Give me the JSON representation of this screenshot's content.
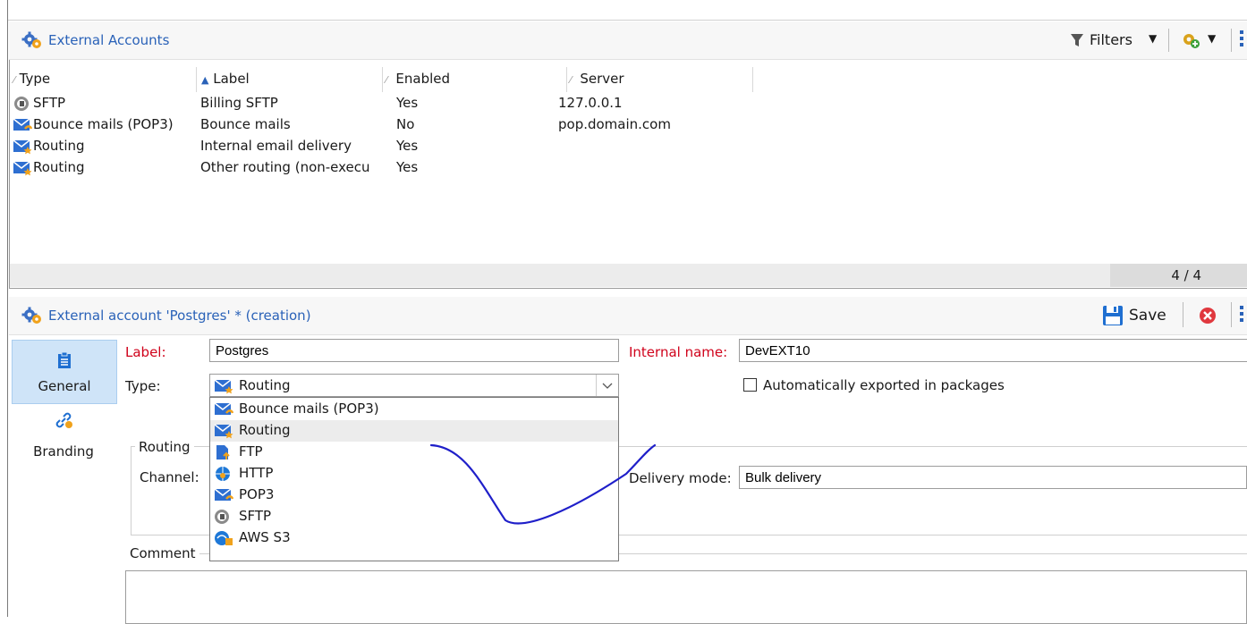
{
  "list_panel": {
    "title": "External Accounts",
    "filters_label": "Filters",
    "columns": {
      "type": "Type",
      "label": "Label",
      "enabled": "Enabled",
      "server": "Server"
    },
    "rows": [
      {
        "icon": "sftp-icon",
        "type": "SFTP",
        "label": "Billing SFTP",
        "enabled": "Yes",
        "server": "127.0.0.1"
      },
      {
        "icon": "bounce-mail-icon",
        "type": "Bounce mails (POP3)",
        "label": "Bounce mails",
        "enabled": "No",
        "server": "pop.domain.com"
      },
      {
        "icon": "routing-icon",
        "type": "Routing",
        "label": "Internal email delivery",
        "enabled": "Yes",
        "server": ""
      },
      {
        "icon": "routing-icon",
        "type": "Routing",
        "label": "Other routing (non-execu",
        "enabled": "Yes",
        "server": ""
      }
    ],
    "count": "4 / 4"
  },
  "form_panel": {
    "title": "External account 'Postgres' * (creation)",
    "save_label": "Save",
    "nav": [
      {
        "label": "General",
        "icon": "clipboard-icon",
        "active": true
      },
      {
        "label": "Branding",
        "icon": "link-icon",
        "active": false
      }
    ],
    "label_caption": "Label:",
    "label_value": "Postgres",
    "internal_name_caption": "Internal name:",
    "internal_name_value": "DevEXT10",
    "type_caption": "Type:",
    "type_value": "Routing",
    "auto_export_label": "Automatically exported in packages",
    "routing_group": "Routing",
    "channel_caption": "Channel:",
    "delivery_mode_caption": "Delivery mode:",
    "delivery_mode_value": "Bulk delivery",
    "comment_caption": "Comment",
    "type_options": [
      {
        "label": "Bounce mails (POP3)",
        "icon": "bounce-mail-icon"
      },
      {
        "label": "Routing",
        "icon": "routing-icon",
        "selected": true
      },
      {
        "label": "FTP",
        "icon": "ftp-icon"
      },
      {
        "label": "HTTP",
        "icon": "http-icon"
      },
      {
        "label": "POP3",
        "icon": "pop3-icon"
      },
      {
        "label": "SFTP",
        "icon": "sftp-icon"
      },
      {
        "label": "AWS S3",
        "icon": "aws-s3-icon"
      }
    ]
  },
  "colors": {
    "title_blue": "#2a62b8",
    "required_red": "#d0021b",
    "nav_active": "#cfe4f8",
    "ink": "#1f1fc9"
  }
}
